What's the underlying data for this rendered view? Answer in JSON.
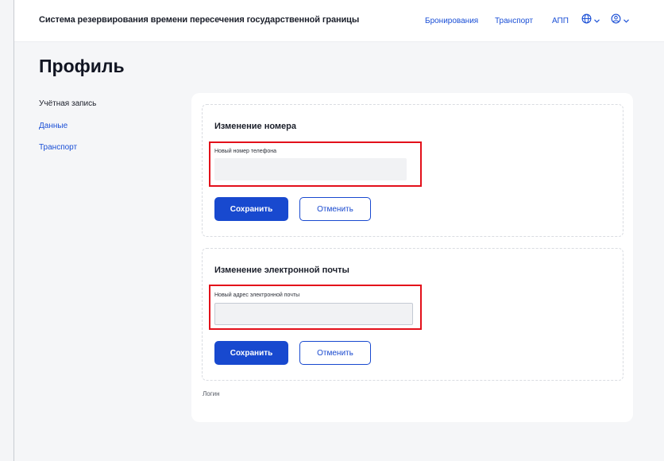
{
  "header": {
    "app_title": "Система резервирования времени пересечения государственной границы",
    "nav": [
      "Бронирования",
      "Транспорт",
      "АПП"
    ],
    "language_icon": "globe-icon",
    "profile_icon": "user-circle-icon"
  },
  "page": {
    "title": "Профиль"
  },
  "sidebar": {
    "items": [
      {
        "label": "Учётная запись"
      },
      {
        "label": "Данные"
      },
      {
        "label": "Транспорт"
      }
    ]
  },
  "phone_section": {
    "title": "Изменение номера",
    "field_label": "Новый номер телефона",
    "value": "",
    "save_label": "Сохранить",
    "cancel_label": "Отменить"
  },
  "email_section": {
    "title": "Изменение электронной почты",
    "field_label": "Новый адрес электронной почты",
    "value": "",
    "save_label": "Сохранить",
    "cancel_label": "Отменить"
  },
  "login": {
    "label": "Логин"
  },
  "colors": {
    "accent": "#1849cf",
    "highlight": "#e3101a"
  }
}
